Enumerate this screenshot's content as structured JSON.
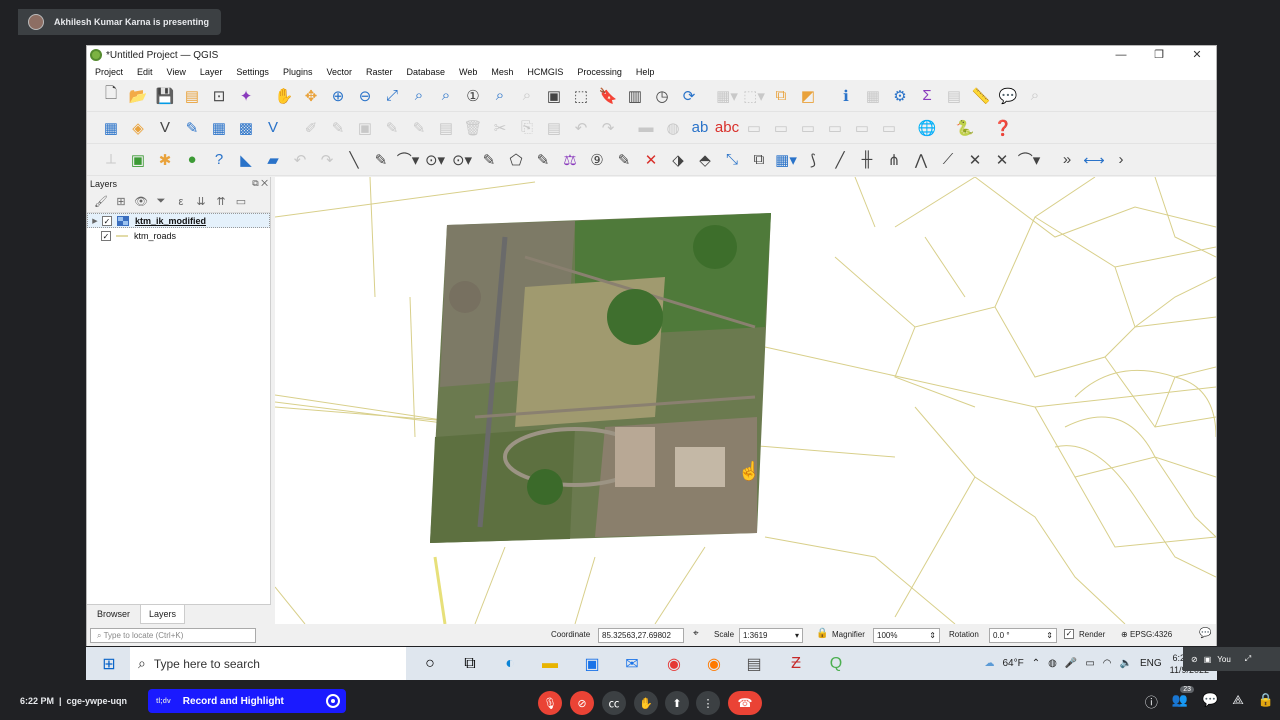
{
  "meet": {
    "presenter_text": "Akhilesh Kumar Karna is presenting",
    "time": "6:22 PM",
    "meeting_code": "cge-ywpe-uqn",
    "record_logo": "tl;dv",
    "record_label": "Record and Highlight",
    "people_count": "23",
    "you_label": "You"
  },
  "qgis": {
    "title": "*Untitled Project — QGIS",
    "menu": [
      "Project",
      "Edit",
      "View",
      "Layer",
      "Settings",
      "Plugins",
      "Vector",
      "Raster",
      "Database",
      "Web",
      "Mesh",
      "HCMGIS",
      "Processing",
      "Help"
    ],
    "layers_panel_title": "Layers",
    "layers": [
      {
        "name": "ktm_ik_modified",
        "checked": true,
        "type": "raster"
      },
      {
        "name": "ktm_roads",
        "checked": true,
        "type": "line"
      }
    ],
    "tabs": [
      "Browser",
      "Layers"
    ],
    "status": {
      "locate_placeholder": "Type to locate (Ctrl+K)",
      "coordinate_label": "Coordinate",
      "coordinate_value": "85.32563,27.69802",
      "scale_label": "Scale",
      "scale_value": "1:3619",
      "magnifier_label": "Magnifier",
      "magnifier_value": "100%",
      "rotation_label": "Rotation",
      "rotation_value": "0.0 °",
      "render_label": "Render",
      "crs": "EPSG:4326"
    }
  },
  "taskbar": {
    "search_placeholder": "Type here to search",
    "weather": "64°F",
    "lang": "ENG",
    "time": "6:22 PM",
    "date": "11/9/2022"
  },
  "colors": {
    "road": "#d8cf8a",
    "meet_bg": "#202124",
    "record_blue": "#1a1aff",
    "hangup_red": "#ea4335"
  }
}
